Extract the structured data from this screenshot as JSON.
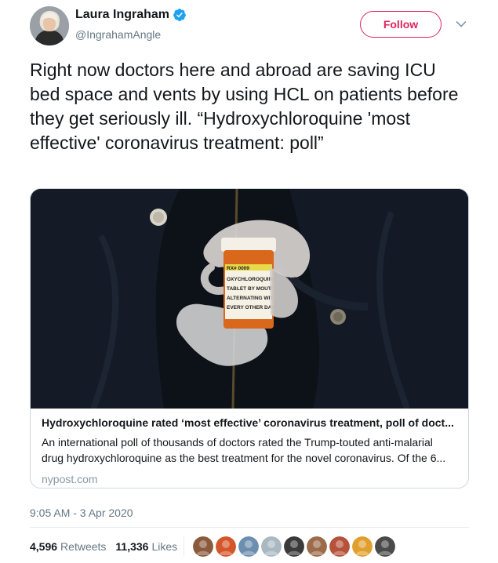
{
  "author": {
    "display_name": "Laura Ingraham",
    "handle": "@IngrahamAngle",
    "verified": true
  },
  "follow_button": {
    "label": "Follow",
    "color": "#e0245e"
  },
  "tweet": {
    "text": "Right now doctors here and abroad are saving ICU bed space and vents by using HCL on patients before they get seriously ill. “Hydroxychloroquine 'most effective' coronavirus treatment: poll”",
    "timestamp": "9:05 AM - 3 Apr 2020"
  },
  "card": {
    "title": "Hydroxychloroquine rated ‘most effective’ coronavirus treatment, poll of doct...",
    "description": "An international poll of thousands of doctors rated the Trump-touted anti-malarial drug hydroxychloroquine as the best treatment for the novel coronavirus. Of the 6...",
    "domain": "nypost.com",
    "image_label_lines": [
      "RX# 0009",
      "OXYCHLOROQUINE SULFATE",
      "TABLET BY MOUTH",
      "ALTERNATING WITH",
      "EVERY OTHER DAY"
    ]
  },
  "stats": {
    "retweets": {
      "count": "4,596",
      "label": "Retweets"
    },
    "likes": {
      "count": "11,336",
      "label": "Likes"
    }
  },
  "likers": [
    {
      "name": "liker-1",
      "color": "#8a5a3c"
    },
    {
      "name": "liker-2",
      "color": "#d4562a"
    },
    {
      "name": "liker-3",
      "color": "#6c8fb0"
    },
    {
      "name": "liker-4",
      "color": "#aab8c2"
    },
    {
      "name": "liker-5",
      "color": "#3a3a3a"
    },
    {
      "name": "liker-6",
      "color": "#9b6b4a"
    },
    {
      "name": "liker-7",
      "color": "#b5523a"
    },
    {
      "name": "liker-8",
      "color": "#e0a030"
    },
    {
      "name": "liker-9",
      "color": "#4a4a4a"
    }
  ],
  "colors": {
    "text": "#14171a",
    "secondary": "#657786",
    "verified": "#1da1f2",
    "border": "#ccd6dd"
  }
}
